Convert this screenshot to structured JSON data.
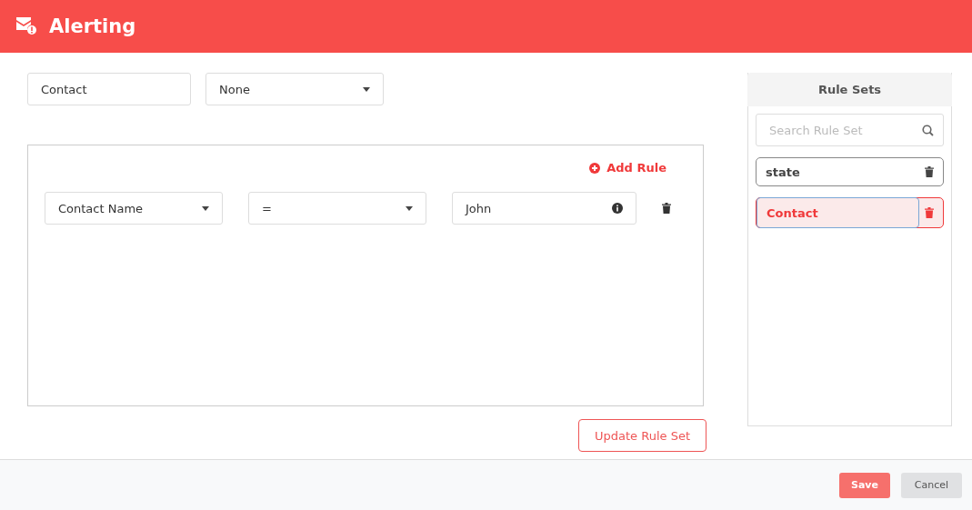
{
  "header": {
    "title": "Alerting"
  },
  "name_field": {
    "value": "Contact"
  },
  "type_select": {
    "value": "None"
  },
  "rules_panel": {
    "add_label": "Add Rule",
    "rules": [
      {
        "field": "Contact Name",
        "operator": "=",
        "value": "John"
      }
    ]
  },
  "update_button": "Update Rule Set",
  "rule_sets": {
    "title": "Rule Sets",
    "search_placeholder": "Search Rule Set",
    "items": [
      {
        "name": "state",
        "selected": false
      },
      {
        "name": "Contact",
        "selected": true
      }
    ]
  },
  "footer": {
    "buttons": [
      {
        "label": "Save",
        "kind": "primary"
      },
      {
        "label": "Cancel",
        "kind": "secondary"
      }
    ]
  }
}
